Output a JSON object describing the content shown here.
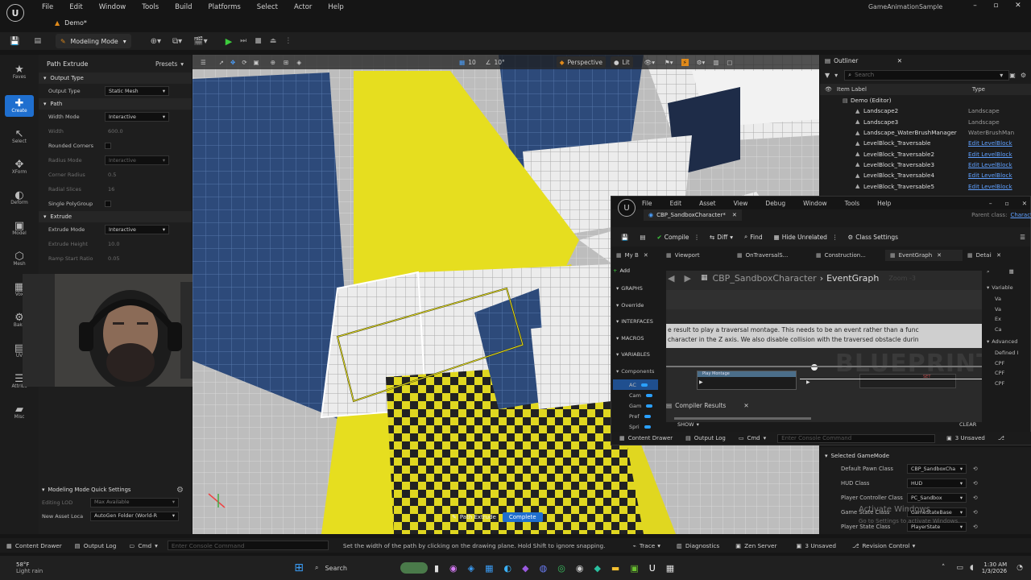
{
  "menubar": {
    "items": [
      "File",
      "Edit",
      "Window",
      "Tools",
      "Build",
      "Platforms",
      "Select",
      "Actor",
      "Help"
    ],
    "project": "GameAnimationSample"
  },
  "level_tab": "Demo*",
  "toolbar": {
    "mode": "Modeling Mode"
  },
  "modes": [
    "Faves",
    "Create",
    "Select",
    "XForm",
    "Deform",
    "Model",
    "Mesh",
    "Vox",
    "Bake",
    "UV",
    "Attribs",
    "Misc"
  ],
  "props": {
    "title": "Path Extrude",
    "presets": "Presets",
    "sections": {
      "output_type": "Output Type",
      "path": "Path",
      "extrude": "Extrude"
    },
    "output_type": {
      "label": "Output Type",
      "value": "Static Mesh"
    },
    "width_mode": {
      "label": "Width Mode",
      "value": "Interactive"
    },
    "width": {
      "label": "Width",
      "value": "600.0"
    },
    "rounded_corners": "Rounded Corners",
    "radius_mode": {
      "label": "Radius Mode",
      "value": "Interactive"
    },
    "corner_radius": {
      "label": "Corner Radius",
      "value": "0.5"
    },
    "radial_slices": {
      "label": "Radial Slices",
      "value": "16"
    },
    "single_polygroup": "Single PolyGroup",
    "extrude_mode": {
      "label": "Extrude Mode",
      "value": "Interactive"
    },
    "extrude_height": {
      "label": "Extrude Height",
      "value": "10.0"
    },
    "ramp_start": {
      "label": "Ramp Start Ratio",
      "value": "0.05"
    },
    "quick_settings": "Modeling Mode Quick Settings",
    "editing_lod": {
      "label": "Editing LOD",
      "value": "Max Available"
    },
    "new_asset": {
      "label": "New Asset Loca",
      "value": "AutoGen Folder (World-R"
    }
  },
  "viewport": {
    "perspective": "Perspective",
    "lit": "Lit",
    "grid": "10",
    "angle": "10°",
    "overlay_label": "Path Extrude",
    "complete": "Complete"
  },
  "outliner": {
    "title": "Outliner",
    "search": "Search",
    "col_label": "Item Label",
    "col_type": "Type",
    "rows": [
      {
        "label": "Demo (Editor)",
        "type": ""
      },
      {
        "label": "Landscape2",
        "type": "Landscape"
      },
      {
        "label": "Landscape3",
        "type": "Landscape"
      },
      {
        "label": "Landscape_WaterBrushManager",
        "type": "WaterBrushMan"
      },
      {
        "label": "LevelBlock_Traversable",
        "type": "Edit LevelBlock"
      },
      {
        "label": "LevelBlock_Traversable2",
        "type": "Edit LevelBlock"
      },
      {
        "label": "LevelBlock_Traversable3",
        "type": "Edit LevelBlock"
      },
      {
        "label": "LevelBlock_Traversable4",
        "type": "Edit LevelBlock"
      },
      {
        "label": "LevelBlock_Traversable5",
        "type": "Edit LevelBlock"
      }
    ]
  },
  "bp": {
    "menu": [
      "File",
      "Edit",
      "Asset",
      "View",
      "Debug",
      "Window",
      "Tools",
      "Help"
    ],
    "tab": "CBP_SandboxCharacter*",
    "parent_label": "Parent class:",
    "parent_value": "Character",
    "tools": [
      "Compile",
      "Diff",
      "Find",
      "Hide Unrelated",
      "Class Settings"
    ],
    "tabs": [
      "My B",
      "Viewport",
      "OnTraversalS...",
      "Construction...",
      "EventGraph",
      "Details"
    ],
    "add": "Add",
    "crumb1": "CBP_SandboxCharacter",
    "crumb2": "EventGraph",
    "zoom": "Zoom -3",
    "left": [
      "GRAPHS",
      "Override",
      "INTERFACES",
      "MACROS",
      "VARIABLES",
      "Components",
      "AC",
      "Cam",
      "Gam",
      "Pref",
      "Spri"
    ],
    "comment1": "e result to play a traversal montage. This needs to be an event rather than a func",
    "comment2": "character in the Z axis. We also disable collision with the traversed obstacle durin",
    "watermark": "BLUEPRINT",
    "node": "Play Montage",
    "compiler": "Compiler Results",
    "show": "SHOW",
    "clear": "CLEAR",
    "details_items": [
      "Variable",
      "Va",
      "Va",
      "Ex",
      "Ca",
      "Advanced",
      "Defined I",
      "CPF",
      "CPF",
      "CPF"
    ],
    "bottom": {
      "drawer": "Content Drawer",
      "log": "Output Log",
      "cmd": "Cmd",
      "console": "Enter Console Command",
      "unsaved": "3 Unsaved"
    }
  },
  "details": {
    "section": "Selected GameMode",
    "rows": [
      {
        "label": "Default Pawn Class",
        "value": "CBP_SandboxCha"
      },
      {
        "label": "HUD Class",
        "value": "HUD"
      },
      {
        "label": "Player Controller Class",
        "value": "PC_Sandbox"
      },
      {
        "label": "Game State Class",
        "value": "GameStateBase"
      },
      {
        "label": "Player State Class",
        "value": "PlayerState"
      }
    ],
    "activate1": "Activate Windows",
    "activate2": "Go to Settings to activate Windows."
  },
  "status": {
    "drawer": "Content Drawer",
    "log": "Output Log",
    "cmd": "Cmd",
    "console": "Enter Console Command",
    "hint": "Set the width of the path by clicking on the drawing plane. Hold Shift to ignore snapping.",
    "trace": "Trace",
    "diag": "Diagnostics",
    "zen": "Zen Server",
    "unsaved": "3 Unsaved",
    "revision": "Revision Control"
  },
  "taskbar": {
    "temp": "58°F",
    "weather": "Light rain",
    "search": "Search",
    "time": "1:30 AM",
    "date": "1/3/2026"
  },
  "colors": {
    "accent": "#1f6fcf",
    "highlight": "#e6de1f",
    "link": "#5fa0ff"
  }
}
